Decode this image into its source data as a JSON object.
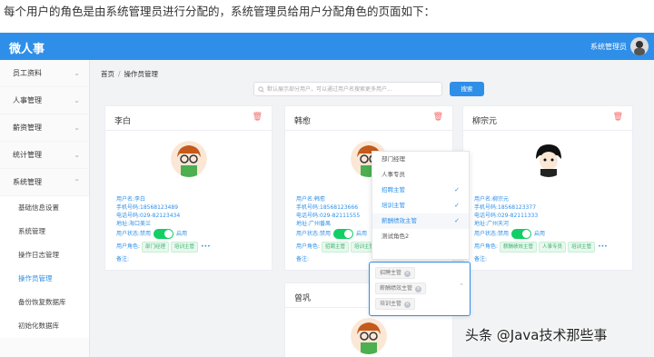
{
  "caption": "每个用户的角色是由系统管理员进行分配的，系统管理员给用户分配角色的页面如下：",
  "app": {
    "brand": "微人事",
    "user_name": "系统管理员"
  },
  "sidebar": {
    "items": [
      {
        "label": "员工资料",
        "arrow": "⌄"
      },
      {
        "label": "人事管理",
        "arrow": "⌄"
      },
      {
        "label": "薪资管理",
        "arrow": "⌄"
      },
      {
        "label": "统计管理",
        "arrow": "⌄"
      },
      {
        "label": "系统管理",
        "arrow": "⌃"
      }
    ],
    "sub_items": [
      {
        "label": "基础信息设置"
      },
      {
        "label": "系统管理"
      },
      {
        "label": "操作日志管理"
      },
      {
        "label": "操作员管理"
      },
      {
        "label": "备份恢复数据库"
      },
      {
        "label": "初始化数据库"
      }
    ]
  },
  "breadcrumb": {
    "home": "首页",
    "sep": "/",
    "current": "操作员管理"
  },
  "search": {
    "placeholder": "默认展示部分用户，可以通过用户名搜索更多用户...",
    "button": "搜索"
  },
  "icons": {
    "search": "search-icon",
    "delete": "trash-icon",
    "check": "check-icon"
  },
  "colors": {
    "primary": "#2f8fe8",
    "danger": "#f56c6c",
    "switch_on": "#13ce66"
  },
  "cards": [
    {
      "name": "李白",
      "username": "用户名:李白",
      "phone": "手机号码:18568123489",
      "tel": "电话号码:029-82123434",
      "address": "地址:海口美兰",
      "status_label": "用户状态:",
      "disabled": "禁用",
      "enabled": "启用",
      "roles_label": "用户角色:",
      "roles": [
        "部门经理",
        "培训主管"
      ],
      "more": "•••",
      "remark": "备注:"
    },
    {
      "name": "韩愈",
      "username": "用户名:韩愈",
      "phone": "手机号码:18568123666",
      "tel": "电话号码:029-82111555",
      "address": "地址:广州番禺",
      "status_label": "用户状态:",
      "disabled": "禁用",
      "enabled": "启用",
      "roles_label": "用户角色:",
      "roles": [
        "招聘主管",
        "培训主管"
      ],
      "more": "•••",
      "remark": "备注:"
    },
    {
      "name": "柳宗元",
      "username": "用户名:柳宗元",
      "phone": "手机号码:18568123377",
      "tel": "电话号码:029-82111333",
      "address": "地址:广州天河",
      "status_label": "用户状态:",
      "disabled": "禁用",
      "enabled": "启用",
      "roles_label": "用户角色:",
      "roles": [
        "薪酬绩效主管",
        "人事专员",
        "培训主管"
      ],
      "more": "•••",
      "remark": "备注:"
    },
    {
      "name": "曾巩"
    }
  ],
  "role_dropdown": {
    "options": [
      {
        "label": "部门经理",
        "selected": false
      },
      {
        "label": "人事专员",
        "selected": false
      },
      {
        "label": "招聘主管",
        "selected": true
      },
      {
        "label": "培训主管",
        "selected": true
      },
      {
        "label": "薪酬绩效主管",
        "selected": true
      },
      {
        "label": "测试角色2",
        "selected": false
      }
    ],
    "check": "✓"
  },
  "role_picker": {
    "tags": [
      "招聘主管",
      "薪酬绩效主管",
      "培训主管"
    ],
    "remove": "×",
    "chevron": "⌃"
  },
  "watermark": "头条 @Java技术那些事"
}
